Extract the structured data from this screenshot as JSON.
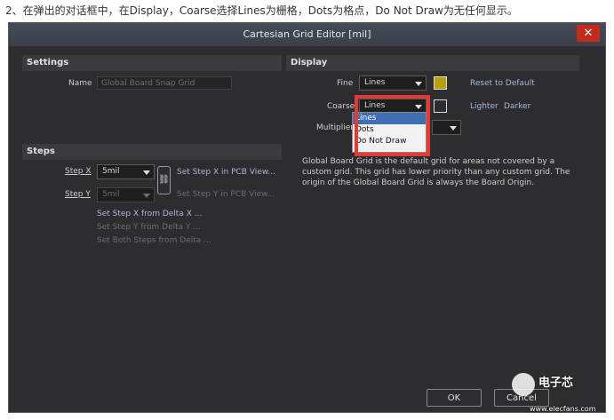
{
  "caption": "2、在弹出的对话框中，在Display，Coarse选择Lines为栅格，Dots为格点，Do Not Draw为无任何显示。",
  "window": {
    "title": "Cartesian Grid Editor [mil]",
    "close_glyph": "✕"
  },
  "settings": {
    "header": "Settings",
    "name_label": "Name",
    "name_value": "Global Board Snap Grid"
  },
  "steps": {
    "header": "Steps",
    "step_x_label": "Step X",
    "step_x_value": "5mil",
    "step_y_label": "Step Y",
    "step_y_value": "5mil",
    "set_x_pcb": "Set Step X in PCB View...",
    "set_y_pcb": "Set Step Y in PCB View...",
    "set_x_delta": "Set Step X from Delta X ...",
    "set_y_delta": "Set Step Y from Delta Y ...",
    "set_both_delta": "Set Both Steps from Delta ..."
  },
  "display": {
    "header": "Display",
    "fine_label": "Fine",
    "fine_value": "Lines",
    "fine_color": "#b5a20a",
    "coarse_label": "Coarse",
    "coarse_value": "Lines",
    "coarse_color": "#2d2d30",
    "multiplier_label": "Multiplier",
    "reset_default": "Reset to Default",
    "lighter": "Lighter",
    "darker": "Darker",
    "dropdown_options": [
      "Lines",
      "Dots",
      "Do Not Draw"
    ],
    "description": "Global Board Grid is the default grid for areas not covered by a custom grid. This grid has lower priority than any custom grid. The origin of the Global Board Grid is always the Board Origin."
  },
  "buttons": {
    "ok": "OK",
    "cancel": "Cancel"
  },
  "watermark": {
    "text": "电子芯",
    "url": "www.elecfans.com"
  },
  "colors": {
    "dialog_bg": "#2d2d30",
    "highlight": "#e53935",
    "close": "#c42b1c"
  }
}
